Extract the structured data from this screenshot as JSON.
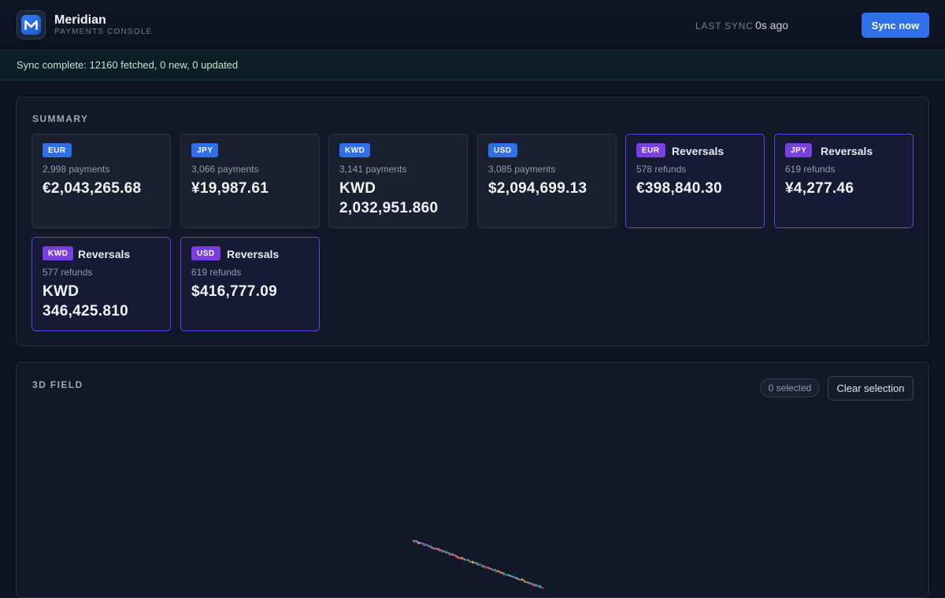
{
  "header": {
    "brand_name": "Meridian",
    "brand_sub": "PAYMENTS CONSOLE",
    "last_sync_label": "LAST SYNC",
    "last_sync_value": "0s ago",
    "sync_button": "Sync now"
  },
  "banner": {
    "message": "Sync complete: 12160 fetched, 0 new, 0 updated"
  },
  "summary": {
    "title": "SUMMARY",
    "cards": [
      {
        "currency": "EUR",
        "kind": "payments",
        "count": "2,998 payments",
        "amount": "€2,043,265.68"
      },
      {
        "currency": "JPY",
        "kind": "payments",
        "count": "3,066 payments",
        "amount": "¥19,987.61"
      },
      {
        "currency": "KWD",
        "kind": "payments",
        "count": "3,141 payments",
        "amount": "KWD 2,032,951.860"
      },
      {
        "currency": "USD",
        "kind": "payments",
        "count": "3,085 payments",
        "amount": "$2,094,699.13"
      },
      {
        "currency": "EUR",
        "kind": "refunds",
        "label": "Reversals",
        "count": "578 refunds",
        "amount": "€398,840.30"
      },
      {
        "currency": "JPY",
        "kind": "refunds",
        "label": "Reversals",
        "count": "619 refunds",
        "amount": "¥4,277.46"
      },
      {
        "currency": "KWD",
        "kind": "refunds",
        "label": "Reversals",
        "count": "577 refunds",
        "amount": "KWD 346,425.810"
      },
      {
        "currency": "USD",
        "kind": "refunds",
        "label": "Reversals",
        "count": "619 refunds",
        "amount": "$416,777.09"
      }
    ]
  },
  "field": {
    "title": "3D FIELD",
    "selected_label": "0 selected",
    "clear_button": "Clear selection"
  },
  "colors": {
    "accent": "#2f6fe8",
    "refund_accent": "#7a3fe0",
    "success_text": "#b9e6d6"
  },
  "icons": {
    "logo": "meridian-logo-icon"
  }
}
